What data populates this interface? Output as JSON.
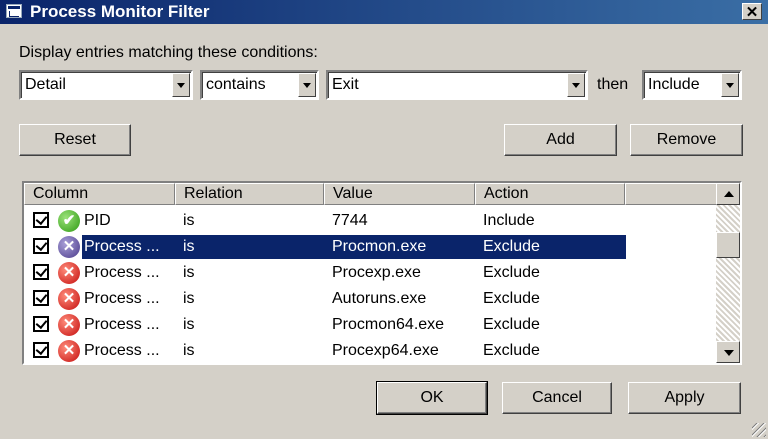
{
  "window": {
    "title": "Process Monitor Filter"
  },
  "filter": {
    "label": "Display entries matching these conditions:",
    "column": "Detail",
    "relation": "contains",
    "value": "Exit",
    "then_label": "then",
    "action": "Include"
  },
  "buttons": {
    "reset": "Reset",
    "add": "Add",
    "remove": "Remove",
    "ok": "OK",
    "cancel": "Cancel",
    "apply": "Apply"
  },
  "table": {
    "headers": [
      "Column",
      "Relation",
      "Value",
      "Action"
    ],
    "rows": [
      {
        "checked": true,
        "icon": "include-icon",
        "column": "PID",
        "relation": "is",
        "value": "7744",
        "action": "Include"
      },
      {
        "checked": true,
        "icon": "exclude-icon",
        "column": "Process ...",
        "relation": "is",
        "value": "Procmon.exe",
        "action": "Exclude"
      },
      {
        "checked": true,
        "icon": "exclude-icon",
        "column": "Process ...",
        "relation": "is",
        "value": "Procexp.exe",
        "action": "Exclude"
      },
      {
        "checked": true,
        "icon": "exclude-icon",
        "column": "Process ...",
        "relation": "is",
        "value": "Autoruns.exe",
        "action": "Exclude"
      },
      {
        "checked": true,
        "icon": "exclude-icon",
        "column": "Process ...",
        "relation": "is",
        "value": "Procmon64.exe",
        "action": "Exclude"
      },
      {
        "checked": true,
        "icon": "exclude-icon",
        "column": "Process ...",
        "relation": "is",
        "value": "Procexp64.exe",
        "action": "Exclude"
      }
    ]
  },
  "colors": {
    "selection": "#0a246a",
    "include_icon": "#2e9a12",
    "exclude_icon": "#c40d0d"
  }
}
